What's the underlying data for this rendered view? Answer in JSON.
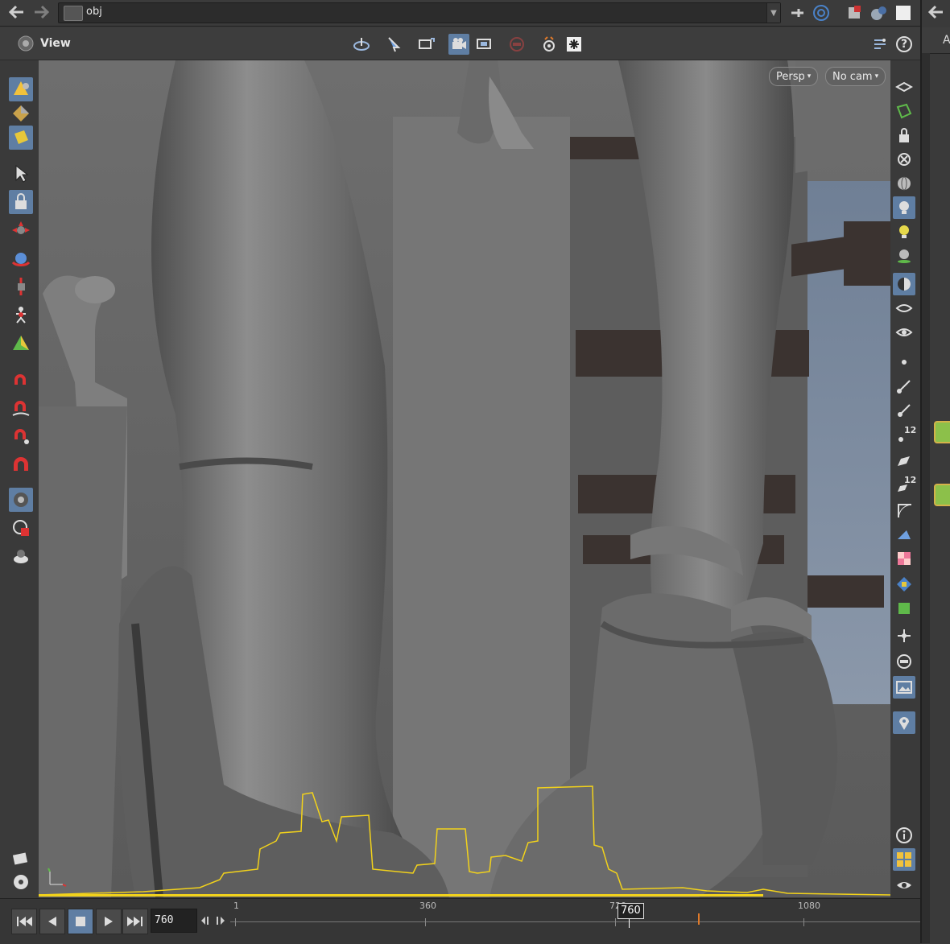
{
  "topbar": {
    "path": "obj",
    "back_icon": "back-arrow-icon",
    "forward_icon": "forward-arrow-icon"
  },
  "viewbar": {
    "title": "View",
    "help_label": "?"
  },
  "viewport": {
    "projection": "Persp",
    "camera": "No cam"
  },
  "right_toolbar": {
    "count_a": "12",
    "count_b": "12"
  },
  "right_strip": {
    "label": "Ac"
  },
  "timeline": {
    "current_frame": "760",
    "frame_flag": "760",
    "ticks": [
      "1",
      "360",
      "720",
      "1080"
    ]
  },
  "colors": {
    "accent": "#5f7ea3",
    "audio_waveform": "#f2d21b",
    "keyframe": "#e07a2a"
  }
}
